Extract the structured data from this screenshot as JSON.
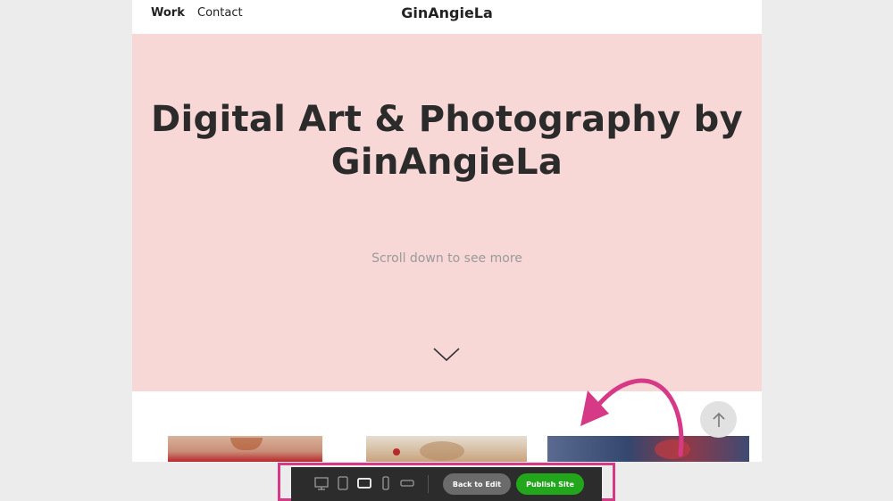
{
  "nav": {
    "work_label": "Work",
    "contact_label": "Contact",
    "brand": "GinAngieLa"
  },
  "hero": {
    "title": "Digital Art & Photography by GinAngieLa",
    "subtitle": "Scroll down to see more",
    "scroll_icon": "chevron-down-icon",
    "background": "#f8d7d7"
  },
  "gallery": {
    "thumbnails": [
      "image-thumbnail",
      "image-thumbnail",
      "image-thumbnail"
    ]
  },
  "back_to_top_icon": "arrow-up-icon",
  "annotation": {
    "color": "#d63a86",
    "icon": "curved-arrow-icon"
  },
  "toolbar": {
    "devices": [
      "desktop-icon",
      "tablet-portrait-icon",
      "tablet-landscape-icon",
      "phone-portrait-icon",
      "phone-landscape-icon"
    ],
    "selected_device": "tablet-landscape-icon",
    "back_label": "Back to Edit",
    "publish_label": "Publish Site",
    "publish_color": "#21a61c"
  }
}
